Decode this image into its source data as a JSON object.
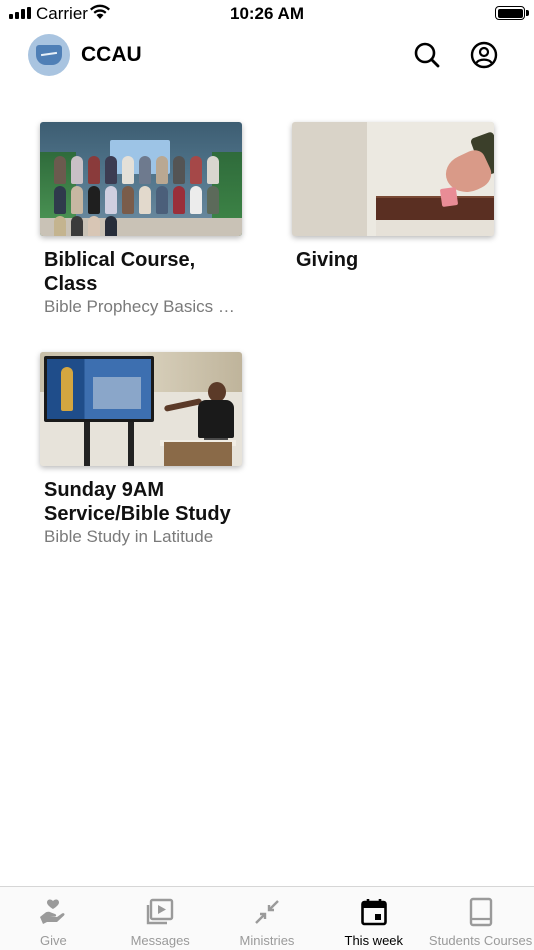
{
  "status_bar": {
    "carrier": "Carrier",
    "time": "10:26 AM"
  },
  "header": {
    "title": "CCAU",
    "logo_icon": "church-shield-logo-icon",
    "search_icon": "search-icon",
    "profile_icon": "user-circle-icon"
  },
  "cards": [
    {
      "title": "Biblical Course, Class",
      "subtitle": "Bible Prophecy Basics Course",
      "image": "group-class-photo"
    },
    {
      "title": "Giving",
      "subtitle": "",
      "image": "hand-giving-offering-photo"
    },
    {
      "title": "Sunday 9AM Service/Bible Study",
      "subtitle": "Bible Study in Latitude",
      "image": "bible-study-presentation-photo"
    }
  ],
  "tabs": [
    {
      "label": "Give",
      "icon": "hand-heart-icon",
      "active": false
    },
    {
      "label": "Messages",
      "icon": "video-library-icon",
      "active": false
    },
    {
      "label": "Ministries",
      "icon": "arrows-inward-icon",
      "active": false
    },
    {
      "label": "This week",
      "icon": "calendar-icon",
      "active": true
    },
    {
      "label": "Students Courses",
      "icon": "book-icon",
      "active": false
    }
  ],
  "colors": {
    "active_tab": "#000000",
    "inactive_tab": "#9a9a9a",
    "subtitle_text": "#7a7a7a"
  }
}
